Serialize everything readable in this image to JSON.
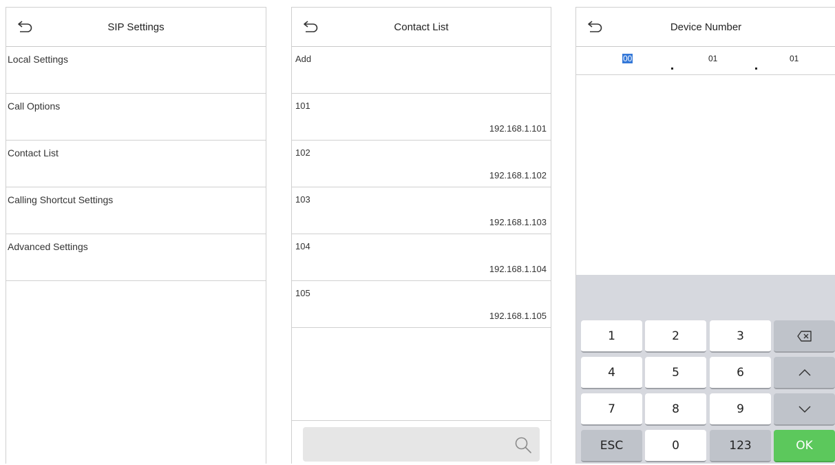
{
  "sip_settings": {
    "title": "SIP Settings",
    "items": [
      {
        "label": "Local Settings"
      },
      {
        "label": "Call Options"
      },
      {
        "label": "Contact List"
      },
      {
        "label": "Calling Shortcut Settings"
      },
      {
        "label": "Advanced Settings"
      }
    ]
  },
  "contact_list": {
    "title": "Contact List",
    "add_label": "Add",
    "contacts": [
      {
        "number": "101",
        "ip": "192.168.1.101"
      },
      {
        "number": "102",
        "ip": "192.168.1.102"
      },
      {
        "number": "103",
        "ip": "192.168.1.103"
      },
      {
        "number": "104",
        "ip": "192.168.1.104"
      },
      {
        "number": "105",
        "ip": "192.168.1.105"
      }
    ],
    "search": {
      "value": "",
      "icon": "search-icon"
    }
  },
  "device_number": {
    "title": "Device Number",
    "segments": [
      "00",
      "01",
      "01"
    ],
    "selected_segment": 0
  },
  "keypad": {
    "keys": {
      "k1": "1",
      "k2": "2",
      "k3": "3",
      "k4": "4",
      "k5": "5",
      "k6": "6",
      "k7": "7",
      "k8": "8",
      "k9": "9",
      "k0": "0",
      "esc": "ESC",
      "mode": "123",
      "ok": "OK"
    },
    "icons": {
      "backspace": "backspace-icon",
      "up": "chevron-up-icon",
      "down": "chevron-down-icon"
    },
    "colors": {
      "ok": "#5cc85c",
      "selection": "#3478d8",
      "keypad_bg": "#d6d8de"
    }
  }
}
